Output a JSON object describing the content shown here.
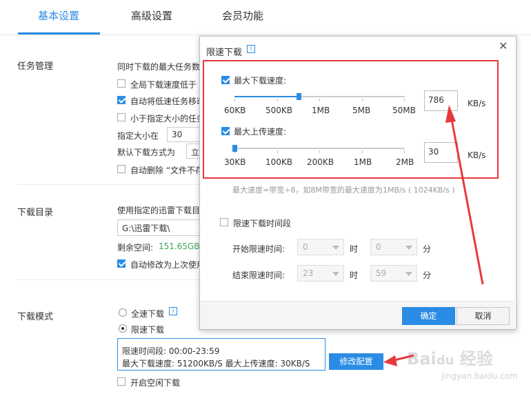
{
  "tabs": [
    {
      "label": "基本设置"
    },
    {
      "label": "高级设置"
    },
    {
      "label": "会员功能"
    }
  ],
  "task": {
    "title": "任务管理",
    "max_tasks_label": "同时下载的最大任务数",
    "speed_below_label": "全局下载速度低于",
    "auto_move_label": "自动将低速任务移动",
    "small_task_label": "小于指定大小的任务",
    "size_label": "指定大小在",
    "size_value": "30",
    "default_mode_label": "默认下载方式为",
    "default_mode_value": "立",
    "auto_delete_label": "自动删除 “文件不存"
  },
  "dir": {
    "title": "下载目录",
    "use_specified_label": "使用指定的迅雷下载目",
    "path_value": "G:\\迅雷下载\\",
    "free_label": "剩余空间:",
    "free_value": "151.65GB",
    "auto_modify_label": "自动修改为上次使用"
  },
  "mode": {
    "title": "下载模式",
    "full_speed_label": "全速下载",
    "limit_speed_label": "限速下载",
    "period_text": "限速时间段:  00:00-23:59",
    "speeds_text": "最大下载速度:  51200KB/S   最大上传速度:  30KB/S",
    "modify_button": "修改配置",
    "idle_label": "开启空闲下载"
  },
  "dialog": {
    "title": "限速下载",
    "close": "✕",
    "download": {
      "label": "最大下载速度:",
      "ticks": [
        "60KB",
        "500KB",
        "1MB",
        "5MB",
        "50MB"
      ],
      "value": "786",
      "unit": "KB/s",
      "slider_fraction": 0.38
    },
    "upload": {
      "label": "最大上传速度:",
      "ticks": [
        "30KB",
        "100KB",
        "200KB",
        "1MB",
        "2MB"
      ],
      "value": "30",
      "unit": "KB/s",
      "slider_fraction": 0.0
    },
    "hint": "最大速度=带宽÷8，如8M带宽的最大速度为1MB/s ( 1024KB/s )",
    "period_label": "限速下载时间段",
    "start_label": "开始限速时间:",
    "end_label": "结束限速时间:",
    "start_hour": "0",
    "start_min": "0",
    "end_hour": "23",
    "end_min": "59",
    "hour_unit": "时",
    "min_unit": "分",
    "ok": "确定",
    "cancel": "取消"
  },
  "watermark": "Baidu 经验 jingyan.baidu.com",
  "colors": {
    "accent": "#2a8ce4",
    "highlight": "#e8383d",
    "free_space": "#3aa55a"
  }
}
